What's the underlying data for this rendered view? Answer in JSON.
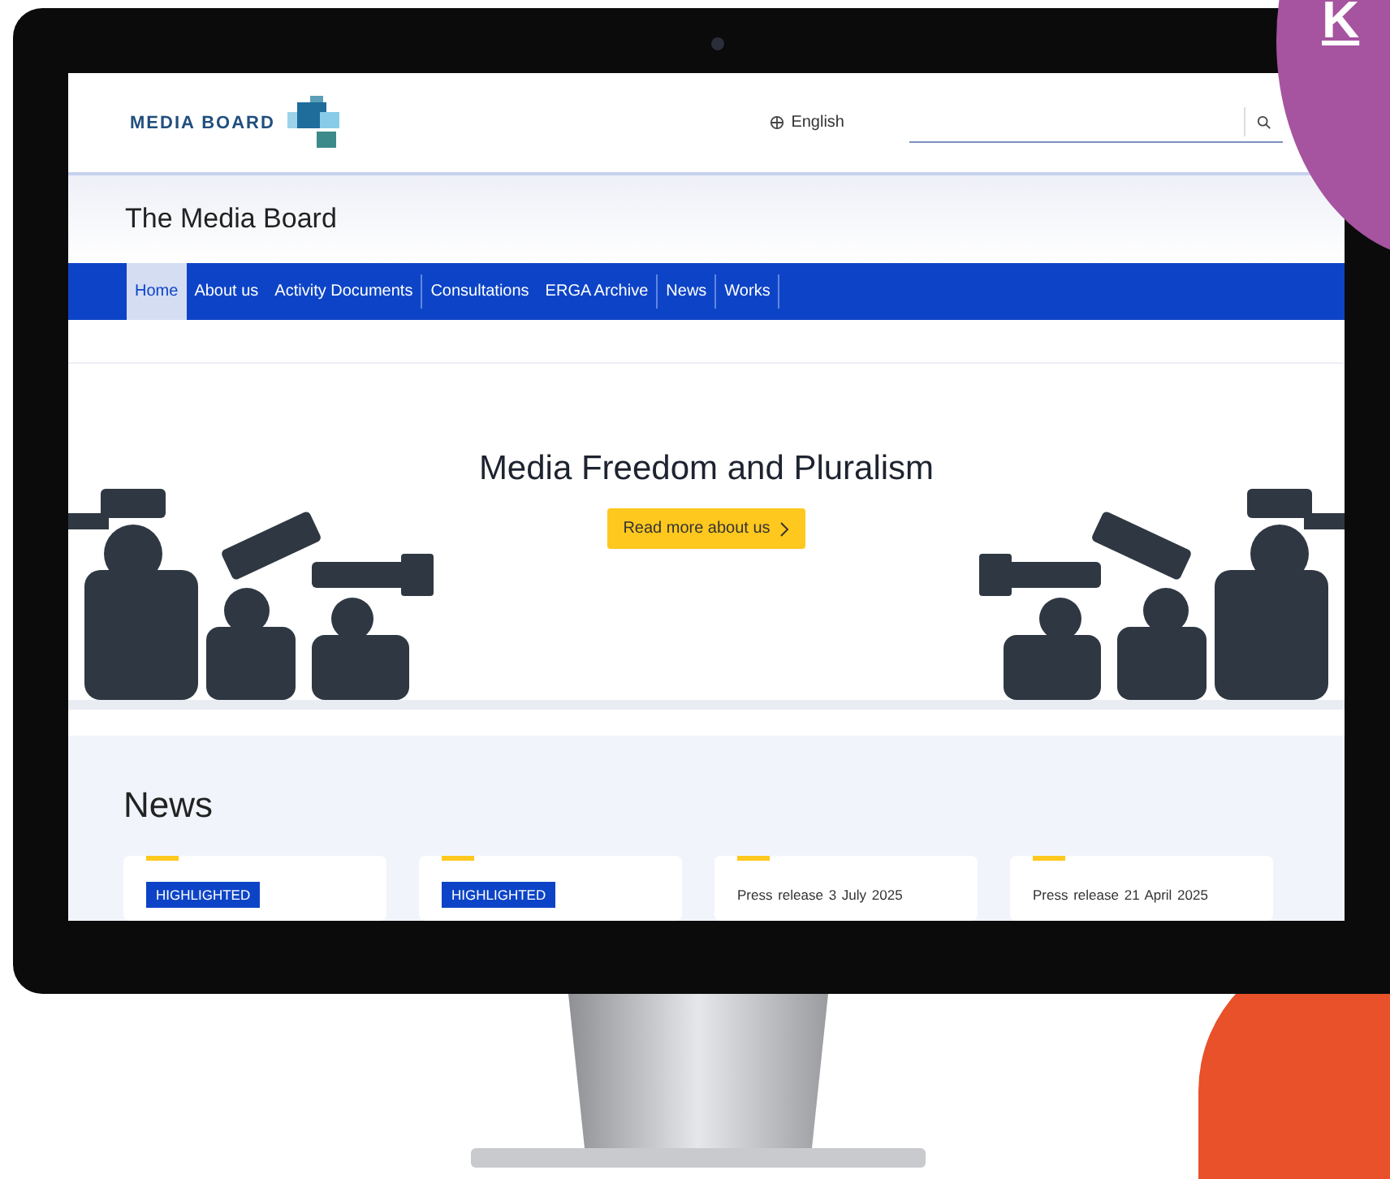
{
  "decor": {
    "letter": "K"
  },
  "site": {
    "logo": "MEDIA BOARD",
    "language": "English",
    "title": "The Media Board",
    "nav": [
      {
        "label": "Home",
        "selected": true
      },
      {
        "label": "About us",
        "selected": false
      },
      {
        "label": "Activity Documents",
        "selected": false
      },
      {
        "label": "Consultations",
        "selected": false
      },
      {
        "label": "ERGA Archive",
        "selected": false
      },
      {
        "label": "News",
        "selected": false
      },
      {
        "label": "Works",
        "selected": false
      }
    ],
    "hero": {
      "title": "Media Freedom and Pluralism",
      "button": "Read more about us"
    },
    "news": {
      "heading": "News",
      "cards": [
        {
          "kind": "highlighted",
          "badge": "HIGHLIGHTED"
        },
        {
          "kind": "highlighted",
          "badge": "HIGHLIGHTED"
        },
        {
          "kind": "press",
          "type": "Press release",
          "date": "3 July 2025"
        },
        {
          "kind": "press",
          "type": "Press release",
          "date": "21 April 2025"
        }
      ]
    }
  }
}
